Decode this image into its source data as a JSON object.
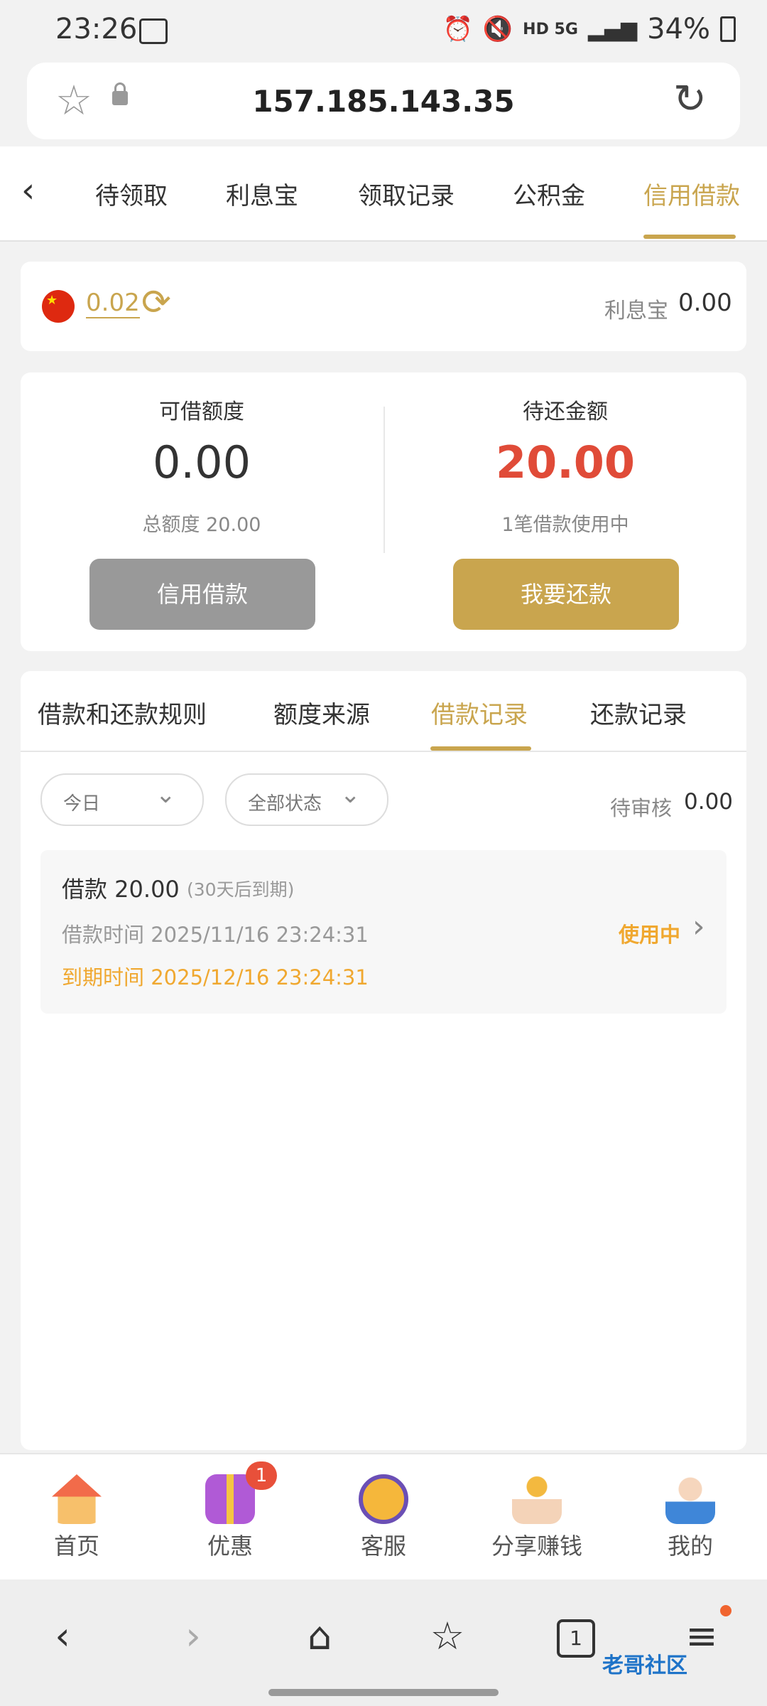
{
  "status": {
    "time": "23:26",
    "indicators": "HD  5G",
    "battery": "34%"
  },
  "browser": {
    "url": "157.185.143.35"
  },
  "top_tabs": [
    {
      "label": "待领取"
    },
    {
      "label": "利息宝"
    },
    {
      "label": "领取记录"
    },
    {
      "label": "公积金"
    },
    {
      "label": "信用借款",
      "active": true
    }
  ],
  "balance_card": {
    "amount": "0.02",
    "label": "利息宝",
    "value": "0.00"
  },
  "credit_card": {
    "available_label": "可借额度",
    "available_value": "0.00",
    "total_label": "总额度 20.00",
    "pending_label": "待还金额",
    "pending_value": "20.00",
    "pending_note": "1笔借款使用中",
    "borrow_button": "信用借款",
    "repay_button": "我要还款"
  },
  "record_tabs": [
    {
      "label": "借款和还款规则"
    },
    {
      "label": "额度来源"
    },
    {
      "label": "借款记录",
      "active": true
    },
    {
      "label": "还款记录"
    }
  ],
  "filters": {
    "date": "今日",
    "status": "全部状态",
    "pending_label": "待审核",
    "pending_value": "0.00"
  },
  "loan_record": {
    "title": "借款 20.00",
    "term": "(30天后到期)",
    "borrow_time": "借款时间 2025/11/16 23:24:31",
    "due_time": "到期时间 2025/12/16 23:24:31",
    "status": "使用中"
  },
  "bottom_tabs": [
    {
      "label": "首页"
    },
    {
      "label": "优惠",
      "badge": "1",
      "active": true
    },
    {
      "label": "客服"
    },
    {
      "label": "分享赚钱"
    },
    {
      "label": "我的"
    }
  ],
  "browser_tabs_count": "1",
  "watermark": "老哥社区",
  "colors": {
    "accent": "#c9a54e",
    "red": "#e04b38",
    "orange": "#f0a830",
    "gray_button": "#999999"
  }
}
